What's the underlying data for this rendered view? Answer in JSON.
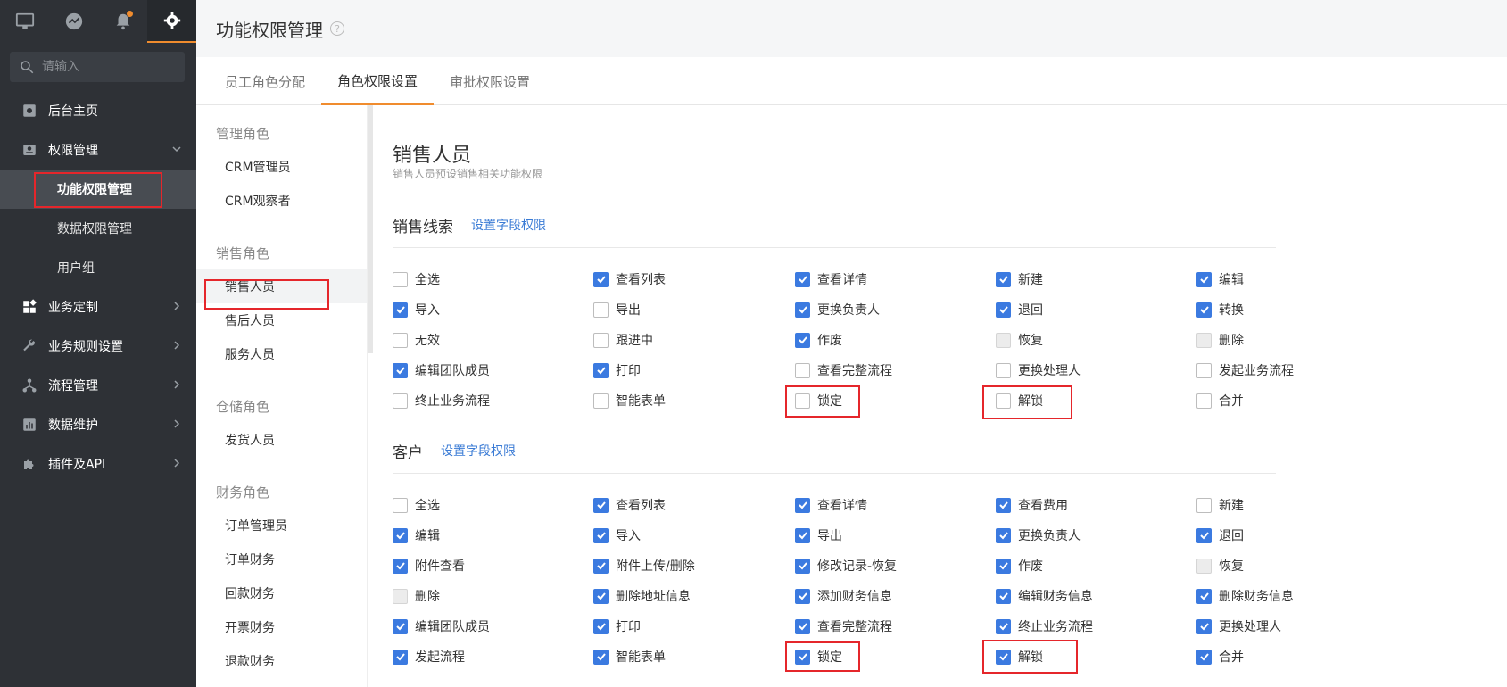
{
  "sidebar": {
    "search_placeholder": "请输入",
    "nav": [
      {
        "label": "后台主页"
      },
      {
        "label": "权限管理"
      },
      {
        "label": "功能权限管理"
      },
      {
        "label": "数据权限管理"
      },
      {
        "label": "用户组"
      },
      {
        "label": "业务定制"
      },
      {
        "label": "业务规则设置"
      },
      {
        "label": "流程管理"
      },
      {
        "label": "数据维护"
      },
      {
        "label": "插件及API"
      }
    ]
  },
  "header": {
    "title": "功能权限管理",
    "help": "?"
  },
  "tabs": [
    {
      "label": "员工角色分配"
    },
    {
      "label": "角色权限设置"
    },
    {
      "label": "审批权限设置"
    }
  ],
  "roles": {
    "groups": [
      {
        "name": "管理角色",
        "items": [
          "CRM管理员",
          "CRM观察者"
        ]
      },
      {
        "name": "销售角色",
        "items": [
          "销售人员",
          "售后人员",
          "服务人员"
        ]
      },
      {
        "name": "仓储角色",
        "items": [
          "发货人员"
        ]
      },
      {
        "name": "财务角色",
        "items": [
          "订单管理员",
          "订单财务",
          "回款财务",
          "开票财务",
          "退款财务"
        ]
      }
    ]
  },
  "main": {
    "role_title": "销售人员",
    "role_desc": "销售人员预设销售相关功能权限",
    "sections": [
      {
        "title": "销售线索",
        "link": "设置字段权限",
        "items": [
          {
            "label": "全选",
            "state": "unchecked"
          },
          {
            "label": "查看列表",
            "state": "checked"
          },
          {
            "label": "查看详情",
            "state": "checked"
          },
          {
            "label": "新建",
            "state": "checked"
          },
          {
            "label": "编辑",
            "state": "checked"
          },
          {
            "label": "导入",
            "state": "checked"
          },
          {
            "label": "导出",
            "state": "unchecked"
          },
          {
            "label": "更换负责人",
            "state": "checked"
          },
          {
            "label": "退回",
            "state": "checked"
          },
          {
            "label": "转换",
            "state": "checked"
          },
          {
            "label": "无效",
            "state": "unchecked"
          },
          {
            "label": "跟进中",
            "state": "unchecked"
          },
          {
            "label": "作废",
            "state": "checked"
          },
          {
            "label": "恢复",
            "state": "disabled"
          },
          {
            "label": "删除",
            "state": "disabled"
          },
          {
            "label": "编辑团队成员",
            "state": "checked"
          },
          {
            "label": "打印",
            "state": "checked"
          },
          {
            "label": "查看完整流程",
            "state": "unchecked"
          },
          {
            "label": "更换处理人",
            "state": "unchecked"
          },
          {
            "label": "发起业务流程",
            "state": "unchecked"
          },
          {
            "label": "终止业务流程",
            "state": "unchecked"
          },
          {
            "label": "智能表单",
            "state": "unchecked"
          },
          {
            "label": "锁定",
            "state": "unchecked"
          },
          {
            "label": "解锁",
            "state": "unchecked"
          },
          {
            "label": "合并",
            "state": "unchecked"
          }
        ]
      },
      {
        "title": "客户",
        "link": "设置字段权限",
        "items": [
          {
            "label": "全选",
            "state": "unchecked"
          },
          {
            "label": "查看列表",
            "state": "checked"
          },
          {
            "label": "查看详情",
            "state": "checked"
          },
          {
            "label": "查看费用",
            "state": "checked"
          },
          {
            "label": "新建",
            "state": "unchecked"
          },
          {
            "label": "编辑",
            "state": "checked"
          },
          {
            "label": "导入",
            "state": "checked"
          },
          {
            "label": "导出",
            "state": "checked"
          },
          {
            "label": "更换负责人",
            "state": "checked"
          },
          {
            "label": "退回",
            "state": "checked"
          },
          {
            "label": "附件查看",
            "state": "checked"
          },
          {
            "label": "附件上传/删除",
            "state": "checked"
          },
          {
            "label": "修改记录-恢复",
            "state": "checked"
          },
          {
            "label": "作废",
            "state": "checked"
          },
          {
            "label": "恢复",
            "state": "disabled"
          },
          {
            "label": "删除",
            "state": "disabled"
          },
          {
            "label": "删除地址信息",
            "state": "checked"
          },
          {
            "label": "添加财务信息",
            "state": "checked"
          },
          {
            "label": "编辑财务信息",
            "state": "checked"
          },
          {
            "label": "删除财务信息",
            "state": "checked"
          },
          {
            "label": "编辑团队成员",
            "state": "checked"
          },
          {
            "label": "打印",
            "state": "checked"
          },
          {
            "label": "查看完整流程",
            "state": "checked"
          },
          {
            "label": "终止业务流程",
            "state": "checked"
          },
          {
            "label": "更换处理人",
            "state": "checked"
          },
          {
            "label": "发起流程",
            "state": "checked"
          },
          {
            "label": "智能表单",
            "state": "checked"
          },
          {
            "label": "锁定",
            "state": "checked"
          },
          {
            "label": "解锁",
            "state": "checked"
          },
          {
            "label": "合并",
            "state": "checked"
          }
        ]
      }
    ]
  },
  "colors": {
    "accent": "#f08c2e",
    "checkbox": "#3b7ae0",
    "sidebar": "#2e3136",
    "highlight": "#e5262b",
    "link": "#3a7bd5"
  }
}
